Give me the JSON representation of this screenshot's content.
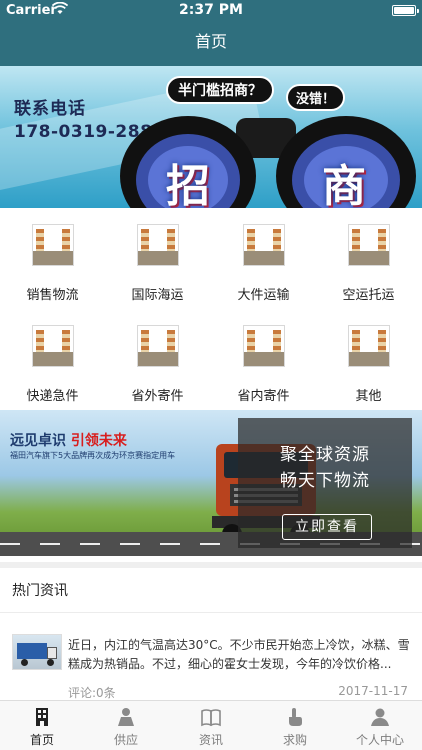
{
  "status_bar": {
    "carrier": "Carrier",
    "time": "2:37 PM"
  },
  "nav": {
    "title": "首页"
  },
  "top_banner": {
    "contact_label": "联系电话",
    "phone": "178-0319-2888",
    "bubble_question": "半门槛招商？",
    "bubble_answer": "没错！",
    "big_char_left": "招",
    "big_char_right": "商"
  },
  "categories": [
    {
      "label": "销售物流",
      "icon": "warehouse-photo-icon"
    },
    {
      "label": "国际海运",
      "icon": "warehouse-photo-icon"
    },
    {
      "label": "大件运输",
      "icon": "warehouse-photo-icon"
    },
    {
      "label": "空运托运",
      "icon": "warehouse-photo-icon"
    },
    {
      "label": "快递急件",
      "icon": "warehouse-photo-icon"
    },
    {
      "label": "省外寄件",
      "icon": "warehouse-photo-icon"
    },
    {
      "label": "省内寄件",
      "icon": "warehouse-photo-icon"
    },
    {
      "label": "其他",
      "icon": "warehouse-photo-icon"
    }
  ],
  "promo_banner": {
    "slogan_plain": "远见卓识",
    "slogan_red": "引领未来",
    "subline": "福田汽车旗下5大品牌再次成为环京赛指定用车",
    "line1": "聚全球资源",
    "line2": "畅天下物流",
    "cta": "立即查看"
  },
  "news": {
    "section_title": "热门资讯",
    "items": [
      {
        "text": "近日，内江的气温高达30°C。不少市民开始恋上冷饮，冰糕、雪糕成为热销品。不过，细心的霍女士发现，今年的冷饮价格...",
        "comments": "评论:0条",
        "date": "2017-11-17"
      }
    ]
  },
  "tabs": [
    {
      "label": "首页",
      "icon": "building-icon",
      "active": true
    },
    {
      "label": "供应",
      "icon": "person-icon",
      "active": false
    },
    {
      "label": "资讯",
      "icon": "book-icon",
      "active": false
    },
    {
      "label": "求购",
      "icon": "hand-tap-icon",
      "active": false
    },
    {
      "label": "个人中心",
      "icon": "user-center-icon",
      "active": false
    }
  ],
  "colors": {
    "header_bg": "#2f6f7e",
    "tab_active": "#222222",
    "tab_inactive": "#7d7d7d"
  }
}
